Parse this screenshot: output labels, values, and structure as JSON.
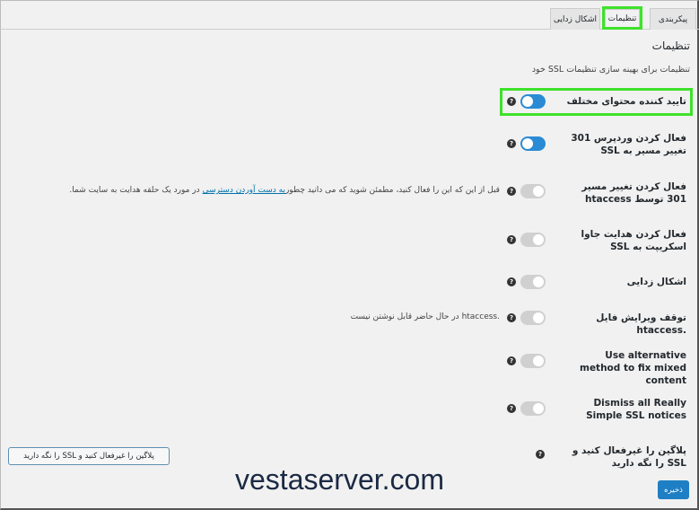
{
  "tabs": [
    {
      "label": "پیکربندی"
    },
    {
      "label": "تنظیمات",
      "active": true
    },
    {
      "label": "اشکال زدایی"
    }
  ],
  "section": {
    "title": "تنظیمات",
    "description": "تنظیمات برای بهینه سازی تنظیمات SSL خود"
  },
  "settings": [
    {
      "label": "تایید کننده محتوای مختلف",
      "enabled": true
    },
    {
      "label": "فعال کردن وردپرس 301 تغییر مسیر به SSL",
      "enabled": true
    },
    {
      "label": "فعال کردن تغییر مسیر 301 توسط htaccess",
      "enabled": false,
      "note_before": "قبل از این که این را فعال کنید، مطمئن شوید که می دانید چطور",
      "note_link": "به دست آوردن دسترسی",
      "note_after": "در مورد یک حلقه هدایت به سایت شما."
    },
    {
      "label": "فعال کردن هدایت جاوا اسکریپت به SSL",
      "enabled": false
    },
    {
      "label": "اشکال زدایی",
      "enabled": false
    },
    {
      "label": "توقف ویرایش فایل .htaccess",
      "enabled": false,
      "note": ".htaccess در حال حاضر قابل نوشتن نیست"
    },
    {
      "label": "Use alternative method to fix mixed content",
      "enabled": false
    },
    {
      "label": "Dismiss all Really Simple SSL notices",
      "enabled": false
    },
    {
      "label": "پلاگین را غیرفعال کنید و SSL را نگه دارید"
    }
  ],
  "buttons": {
    "deactivate_keep_ssl": "پلاگین را غیرفعال کنید و SSL را نگه دارید",
    "save": "ذخیره"
  },
  "watermark": "vestaserver.com",
  "colors": {
    "accent": "#2a8bd4",
    "highlight": "#3ee22b",
    "toggle_off": "#d0d0d0"
  }
}
